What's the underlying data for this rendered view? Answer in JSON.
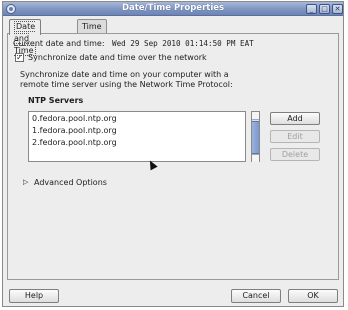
{
  "window": {
    "title": "Date/Time Properties",
    "controls": {
      "minimize": "_",
      "maximize": "□",
      "close": "✕"
    }
  },
  "tabs": [
    {
      "label": "Date and Time",
      "active": true
    },
    {
      "label": "Time Zone",
      "active": false
    }
  ],
  "current": {
    "label": "Current date and time:",
    "value": "Wed 29 Sep 2010 01:14:50 PM EAT"
  },
  "sync": {
    "checked": true,
    "check_glyph": "✓",
    "label": "Synchronize date and time over the network"
  },
  "description": {
    "line1": "Synchronize date and time on your computer with a",
    "line2": "remote time server using the Network Time Protocol:"
  },
  "ntp": {
    "heading": "NTP Servers",
    "servers": [
      "0.fedora.pool.ntp.org",
      "1.fedora.pool.ntp.org",
      "2.fedora.pool.ntp.org"
    ],
    "buttons": {
      "add": "Add",
      "edit": "Edit",
      "delete": "Delete"
    }
  },
  "advanced": {
    "arrow": "▷",
    "label": "Advanced Options"
  },
  "footer": {
    "help": "Help",
    "cancel": "Cancel",
    "ok": "OK"
  }
}
